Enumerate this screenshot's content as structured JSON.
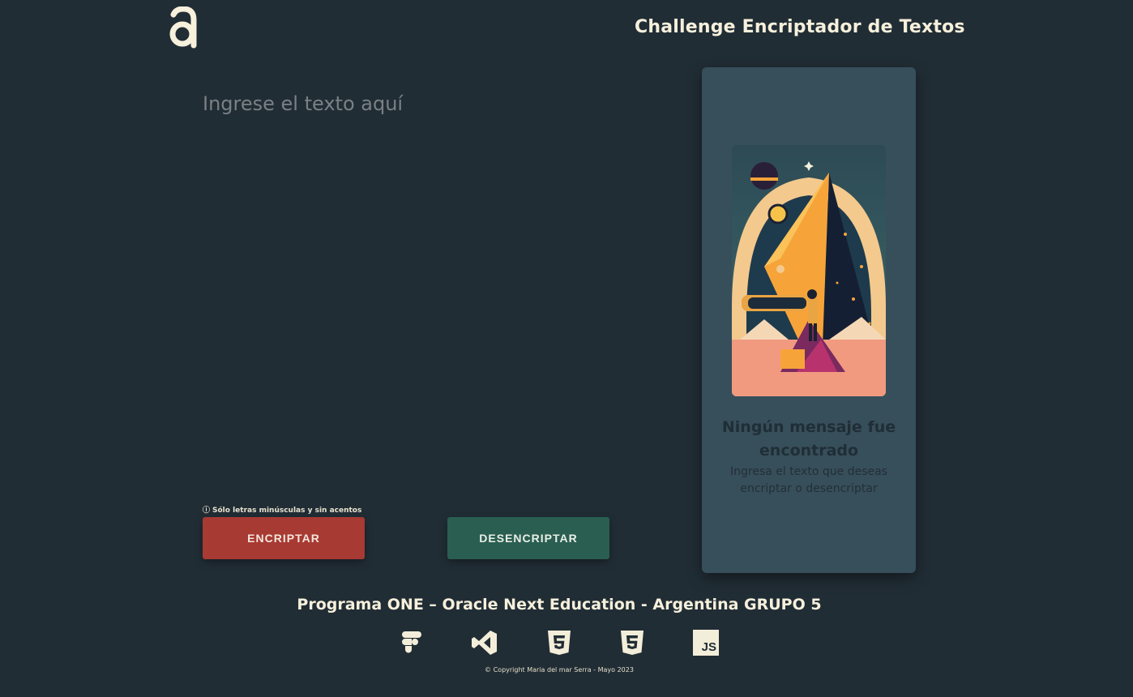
{
  "header": {
    "logo_icon": "alura-a-logo",
    "title": "Challenge Encriptador de Textos"
  },
  "input": {
    "placeholder": "Ingrese el texto aquí",
    "value": ""
  },
  "hint": {
    "icon": "info-icon",
    "text": "Sólo letras minúsculas y sin acentos"
  },
  "buttons": {
    "encrypt_label": "ENCRIPTAR",
    "decrypt_label": "DESENCRIPTAR"
  },
  "output_panel": {
    "illustration": "astronaut-telescope-pyramid-illustration",
    "heading": "Ningún mensaje fue encontrado",
    "message": "Ingresa el texto que deseas encriptar o desencriptar"
  },
  "footer": {
    "title": "Programa ONE – Oracle Next Education - Argentina GRUPO 5",
    "tech_icons": [
      "figma-icon",
      "vscode-icon",
      "html5-icon",
      "css3-icon",
      "javascript-icon"
    ],
    "js_badge_text": "JS",
    "copyright": "© Copyright Maria del mar Serra - Mayo 2023"
  },
  "colors": {
    "background": "#212d35",
    "panel": "#374f5b",
    "encrypt_button": "#a73a33",
    "decrypt_button": "#2a5e51",
    "text_light": "#f6f0dc"
  }
}
